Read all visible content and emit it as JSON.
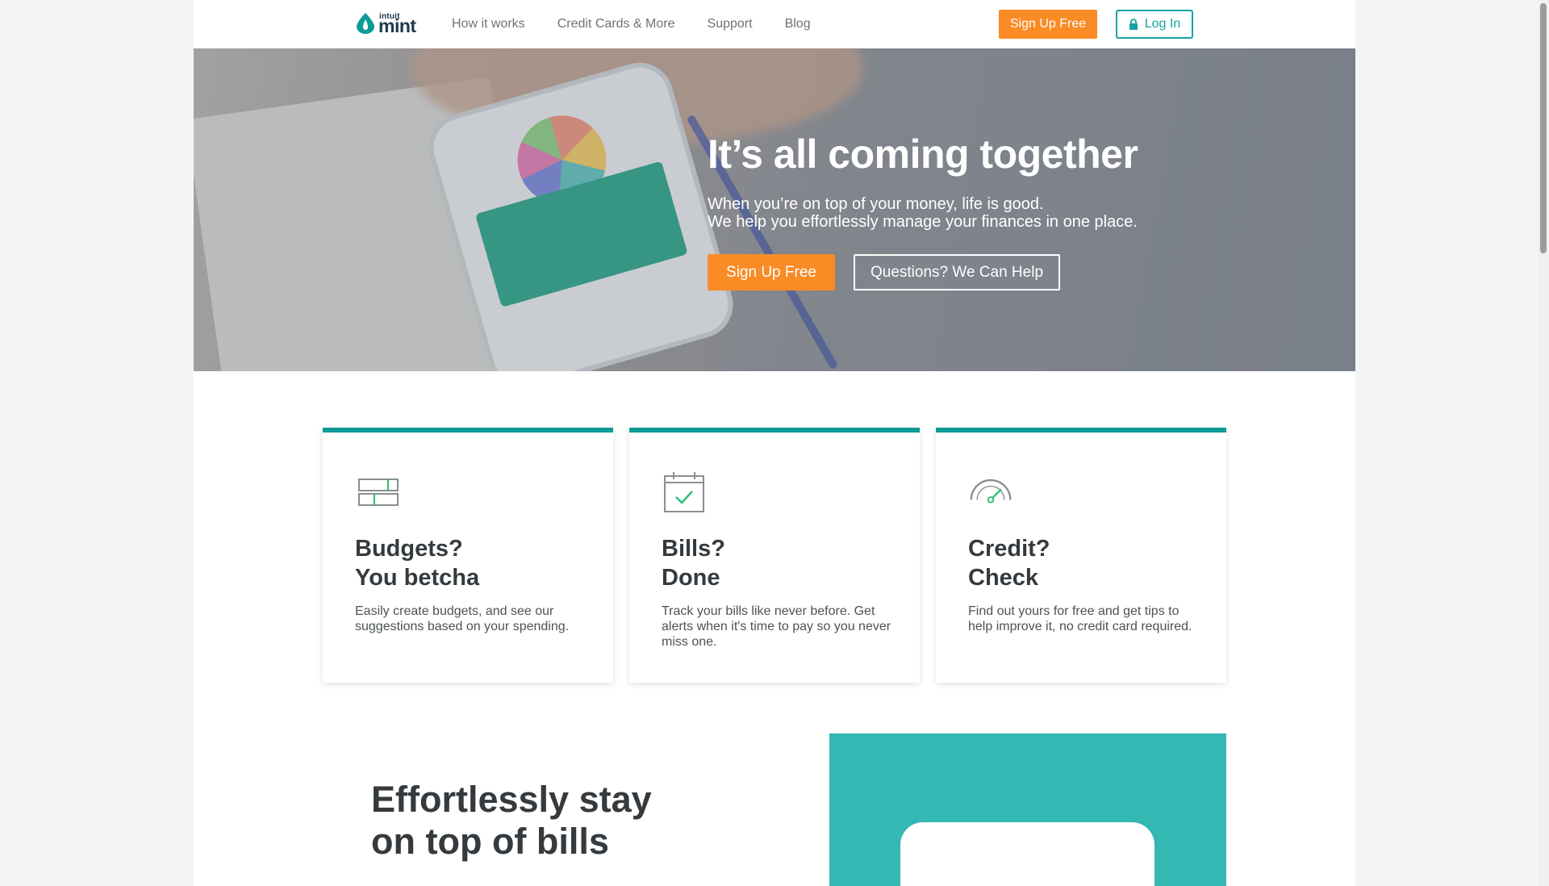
{
  "brand": {
    "intuit": "intuit",
    "mint": "mint"
  },
  "nav": {
    "links": [
      "How it works",
      "Credit Cards & More",
      "Support",
      "Blog"
    ],
    "signup_label": "Sign Up Free",
    "login_label": "Log In"
  },
  "hero": {
    "title": "It’s all coming together",
    "subtitle_line1": "When you’re on top of your money, life is good.",
    "subtitle_line2": "We help you effortlessly manage your finances in one place.",
    "signup_label": "Sign Up Free",
    "help_label": "Questions? We Can Help"
  },
  "cards": [
    {
      "icon": "budget-icon",
      "title_line1": "Budgets?",
      "title_line2": "You betcha",
      "desc": "Easily create budgets, and see our suggestions based on your spending."
    },
    {
      "icon": "calendar-check-icon",
      "title_line1": "Bills?",
      "title_line2": "Done",
      "desc": "Track your bills like never before. Get alerts when it's time to pay so you never miss one."
    },
    {
      "icon": "gauge-icon",
      "title_line1": "Credit?",
      "title_line2": "Check",
      "desc": "Find out yours for free and get tips to help improve it, no credit card required."
    }
  ],
  "section2": {
    "title_line1": "Effortlessly stay",
    "title_line2": "on top of bills"
  },
  "colors": {
    "orange": "#fa8b25",
    "teal": "#0c9a96",
    "teal_panel": "#33b8b3",
    "text_dark": "#353a3e"
  }
}
